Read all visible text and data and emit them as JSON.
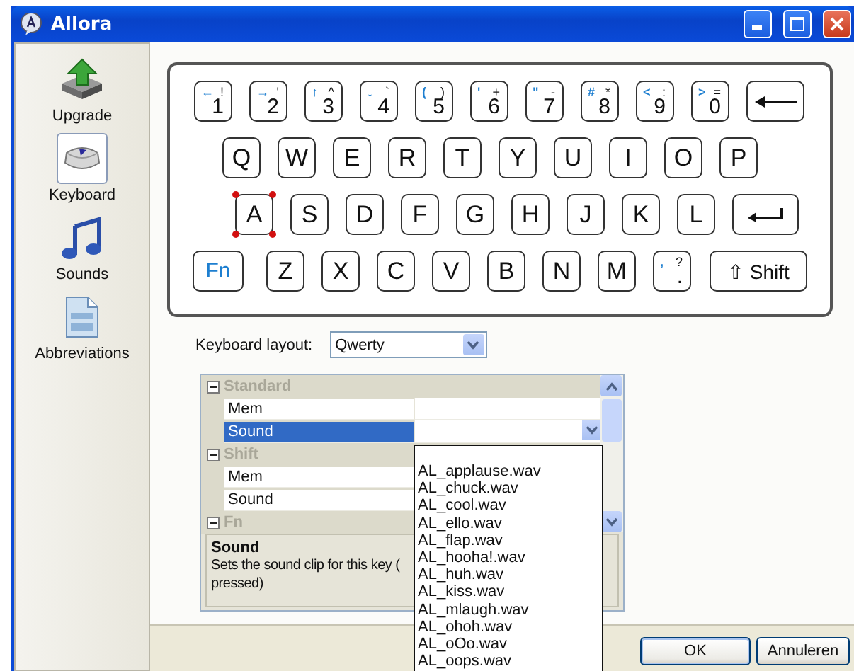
{
  "window": {
    "title": "Allora"
  },
  "sidebar": {
    "items": [
      {
        "label": "Upgrade",
        "selected": false
      },
      {
        "label": "Keyboard",
        "selected": true
      },
      {
        "label": "Sounds",
        "selected": false
      },
      {
        "label": "Abbreviations",
        "selected": false
      }
    ]
  },
  "keyboard": {
    "rows": [
      [
        {
          "kind": "char",
          "label": "1",
          "fn": "←",
          "shift": "!",
          "selected": false
        },
        {
          "kind": "char",
          "label": "2",
          "fn": "→",
          "shift": "'",
          "selected": false
        },
        {
          "kind": "char",
          "label": "3",
          "fn": "↑",
          "shift": "^",
          "selected": false
        },
        {
          "kind": "char",
          "label": "4",
          "fn": "↓",
          "shift": "`",
          "selected": false
        },
        {
          "kind": "char",
          "label": "5",
          "fn": "(",
          "shift": ")",
          "selected": false
        },
        {
          "kind": "char",
          "label": "6",
          "fn": "'",
          "shift": "+",
          "selected": false
        },
        {
          "kind": "char",
          "label": "7",
          "fn": "\"",
          "shift": "-",
          "selected": false
        },
        {
          "kind": "char",
          "label": "8",
          "fn": "#",
          "shift": "*",
          "selected": false
        },
        {
          "kind": "char",
          "label": "9",
          "fn": "<",
          "shift": ":",
          "selected": false
        },
        {
          "kind": "char",
          "label": "0",
          "fn": ">",
          "shift": "=",
          "selected": false
        },
        {
          "kind": "backspace",
          "selected": false
        }
      ],
      [
        {
          "kind": "letter",
          "label": "Q",
          "selected": false
        },
        {
          "kind": "letter",
          "label": "W",
          "selected": false
        },
        {
          "kind": "letter",
          "label": "E",
          "selected": false
        },
        {
          "kind": "letter",
          "label": "R",
          "selected": false
        },
        {
          "kind": "letter",
          "label": "T",
          "selected": false
        },
        {
          "kind": "letter",
          "label": "Y",
          "selected": false
        },
        {
          "kind": "letter",
          "label": "U",
          "selected": false
        },
        {
          "kind": "letter",
          "label": "I",
          "selected": false
        },
        {
          "kind": "letter",
          "label": "O",
          "selected": false
        },
        {
          "kind": "letter",
          "label": "P",
          "selected": false
        }
      ],
      [
        {
          "kind": "letter",
          "label": "A",
          "selected": true
        },
        {
          "kind": "letter",
          "label": "S",
          "selected": false
        },
        {
          "kind": "letter",
          "label": "D",
          "selected": false
        },
        {
          "kind": "letter",
          "label": "F",
          "selected": false
        },
        {
          "kind": "letter",
          "label": "G",
          "selected": false
        },
        {
          "kind": "letter",
          "label": "H",
          "selected": false
        },
        {
          "kind": "letter",
          "label": "J",
          "selected": false
        },
        {
          "kind": "letter",
          "label": "K",
          "selected": false
        },
        {
          "kind": "letter",
          "label": "L",
          "selected": false
        },
        {
          "kind": "enter",
          "selected": false
        }
      ],
      [
        {
          "kind": "fn",
          "label": "Fn",
          "selected": false
        },
        {
          "kind": "letter",
          "label": "Z",
          "selected": false
        },
        {
          "kind": "letter",
          "label": "X",
          "selected": false
        },
        {
          "kind": "letter",
          "label": "C",
          "selected": false
        },
        {
          "kind": "letter",
          "label": "V",
          "selected": false
        },
        {
          "kind": "letter",
          "label": "B",
          "selected": false
        },
        {
          "kind": "letter",
          "label": "N",
          "selected": false
        },
        {
          "kind": "letter",
          "label": "M",
          "selected": false
        },
        {
          "kind": "char",
          "label": ".",
          "fn": ",",
          "shift": "?",
          "selected": false
        },
        {
          "kind": "shift",
          "label": "⇧ Shift",
          "selected": false
        }
      ]
    ]
  },
  "layout_field": {
    "label": "Keyboard layout:",
    "value": "Qwerty"
  },
  "property_grid": {
    "categories": [
      {
        "name": "Standard",
        "expanded": true,
        "properties": [
          {
            "name": "Mem",
            "selected": false
          },
          {
            "name": "Sound",
            "selected": true
          }
        ]
      },
      {
        "name": "Shift",
        "expanded": true,
        "properties": [
          {
            "name": "Mem",
            "selected": false
          },
          {
            "name": "Sound",
            "selected": false
          }
        ]
      },
      {
        "name": "Fn",
        "expanded": true
      }
    ],
    "description": {
      "title": "Sound",
      "lines": [
        "Sets the sound clip for this key (",
        "pressed)"
      ]
    }
  },
  "sound_dropdown": {
    "options": [
      "AL_applause.wav",
      "AL_chuck.wav",
      "AL_cool.wav",
      "AL_ello.wav",
      "AL_flap.wav",
      "AL_hooha!.wav",
      "AL_huh.wav",
      "AL_kiss.wav",
      "AL_mlaugh.wav",
      "AL_ohoh.wav",
      "AL_oOo.wav",
      "AL_oops.wav"
    ]
  },
  "buttons": [
    "OK",
    "Annuleren"
  ]
}
